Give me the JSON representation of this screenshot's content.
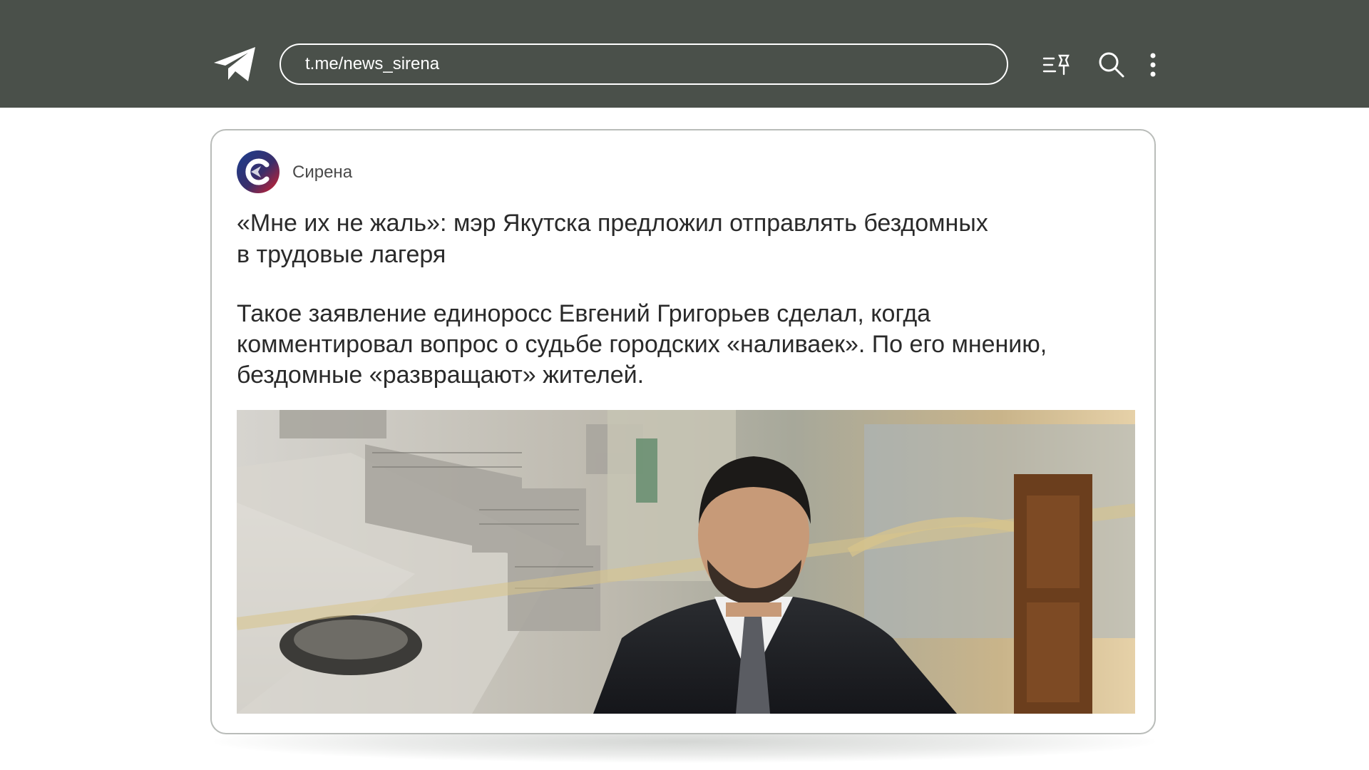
{
  "browser": {
    "url": "t.me/news_sirena",
    "icons": [
      "telegram-icon",
      "pinned-messages-icon",
      "search-icon",
      "more-vertical-icon"
    ]
  },
  "post": {
    "channel_name": "Сирена",
    "title_line1": "«Мне их не жаль»: мэр Якутска предложил отправлять бездомных",
    "title_line2": "в трудовые лагеря",
    "body_line1": "Такое заявление единоросс Евгений Григорьев сделал, когда",
    "body_line2": "комментировал вопрос о судьбе городских «наливаек». По его мнению,",
    "body_line3": "бездомные «развращают» жителей."
  },
  "colors": {
    "header_bg": "#4a504a",
    "text": "#2a2a2a",
    "card_border": "#b9bcb9"
  }
}
